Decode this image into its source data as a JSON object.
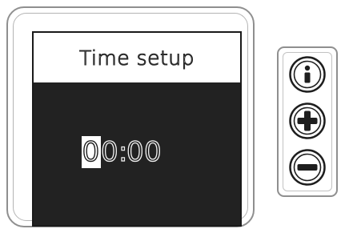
{
  "screen": {
    "title": "Time setup",
    "time": {
      "digits": [
        "0",
        "0",
        "0",
        "0"
      ],
      "separator": ":",
      "selected_index": 0
    }
  },
  "buttons": {
    "info": {
      "icon": "info-icon"
    },
    "plus": {
      "icon": "plus-icon"
    },
    "minus": {
      "icon": "minus-icon"
    }
  },
  "colors": {
    "screen_background": "#222222",
    "frame": "#8f8f8f",
    "highlight": "#ffffff"
  }
}
